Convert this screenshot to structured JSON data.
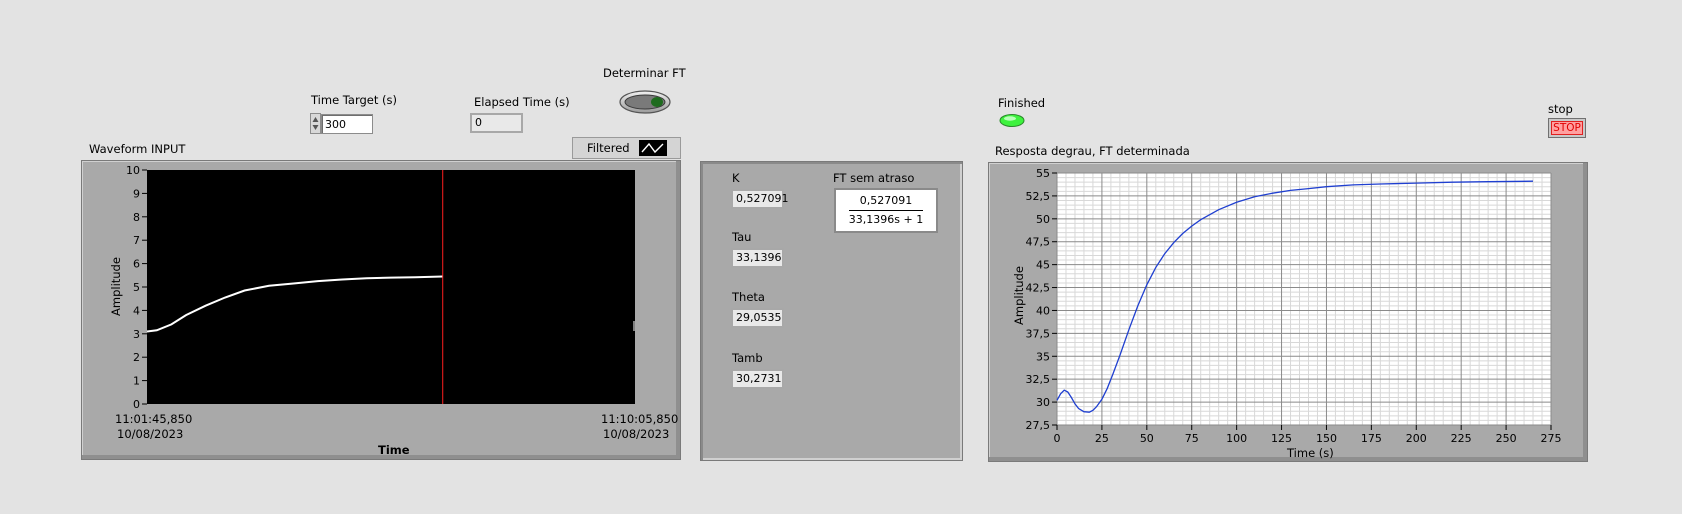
{
  "controls": {
    "time_target_label": "Time Target (s)",
    "time_target_value": "300",
    "elapsed_time_label": "Elapsed Time (s)",
    "elapsed_time_value": "0",
    "determinar_ft_label": "Determinar FT",
    "finished_label": "Finished",
    "stop_label": "stop",
    "stop_button": "STOP"
  },
  "waveform_input": {
    "title": "Waveform INPUT",
    "legend_label": "Filtered",
    "ylabel": "Amplitude",
    "xlabel": "Time",
    "x_start_time": "11:01:45,850",
    "x_start_date": "10/08/2023",
    "x_end_time": "11:10:05,850",
    "x_end_date": "10/08/2023",
    "y_ticks": [
      "0",
      "1",
      "2",
      "3",
      "4",
      "5",
      "6",
      "7",
      "8",
      "9",
      "10"
    ]
  },
  "results": {
    "k_label": "K",
    "k_value": "0,527091",
    "tau_label": "Tau",
    "tau_value": "33,1396",
    "theta_label": "Theta",
    "theta_value": "29,0535",
    "tamb_label": "Tamb",
    "tamb_value": "30,2731",
    "ft_label": "FT sem atraso",
    "ft_numerator": "0,527091",
    "ft_denominator": "33,1396s + 1"
  },
  "chart_data": [
    {
      "type": "line",
      "title": "Waveform INPUT",
      "ylabel": "Amplitude",
      "xlabel": "Time",
      "ylim": [
        0,
        10
      ],
      "x_unit": "fraction of time axis",
      "cursor_x": 0.606,
      "series": [
        {
          "name": "Filtered",
          "color": "#ffffff",
          "x": [
            0,
            0.02,
            0.05,
            0.08,
            0.12,
            0.16,
            0.2,
            0.25,
            0.3,
            0.35,
            0.4,
            0.45,
            0.5,
            0.55,
            0.606
          ],
          "y": [
            3.1,
            3.15,
            3.4,
            3.8,
            4.2,
            4.55,
            4.85,
            5.05,
            5.15,
            5.25,
            5.32,
            5.37,
            5.4,
            5.42,
            5.45
          ]
        }
      ],
      "grid": false
    },
    {
      "type": "line",
      "title": "Resposta degrau, FT determinada",
      "xlabel": "Time (s)",
      "ylabel": "Amplitude",
      "xlim": [
        0,
        275
      ],
      "ylim": [
        27.5,
        55
      ],
      "x_ticks": [
        0,
        25,
        50,
        75,
        100,
        125,
        150,
        175,
        200,
        225,
        250,
        275
      ],
      "y_ticks": [
        "27,5",
        "30",
        "32,5",
        "35",
        "37,5",
        "40",
        "42,5",
        "45",
        "47,5",
        "50",
        "52,5",
        "55"
      ],
      "series": [
        {
          "name": "",
          "color": "#1f3fd0",
          "x": [
            0,
            2,
            4,
            6,
            8,
            10,
            12,
            15,
            18,
            20,
            22,
            25,
            28,
            31,
            35,
            40,
            45,
            50,
            55,
            60,
            65,
            70,
            75,
            80,
            90,
            100,
            110,
            120,
            130,
            140,
            150,
            165,
            180,
            200,
            220,
            240,
            265
          ],
          "y": [
            30.2,
            30.9,
            31.3,
            31.1,
            30.5,
            29.8,
            29.3,
            28.95,
            28.9,
            29.1,
            29.5,
            30.3,
            31.5,
            33.0,
            35.1,
            37.9,
            40.5,
            42.8,
            44.7,
            46.2,
            47.4,
            48.4,
            49.2,
            49.9,
            51.0,
            51.8,
            52.4,
            52.8,
            53.1,
            53.3,
            53.5,
            53.7,
            53.8,
            53.9,
            54.0,
            54.05,
            54.1
          ]
        }
      ],
      "grid": true
    }
  ],
  "step_response": {
    "title": "Resposta degrau, FT determinada",
    "xlabel": "Time (s)",
    "ylabel": "Amplitude"
  },
  "colors": {
    "panel_bg": "#e3e3e3",
    "graph_frame": "#a9a9a9",
    "plot_bg_input": "#000000",
    "plot_bg_step": "#ffffff",
    "cursor": "#ff2020",
    "led_on": "#3ef23e",
    "stop_red": "#ff2a2a"
  }
}
